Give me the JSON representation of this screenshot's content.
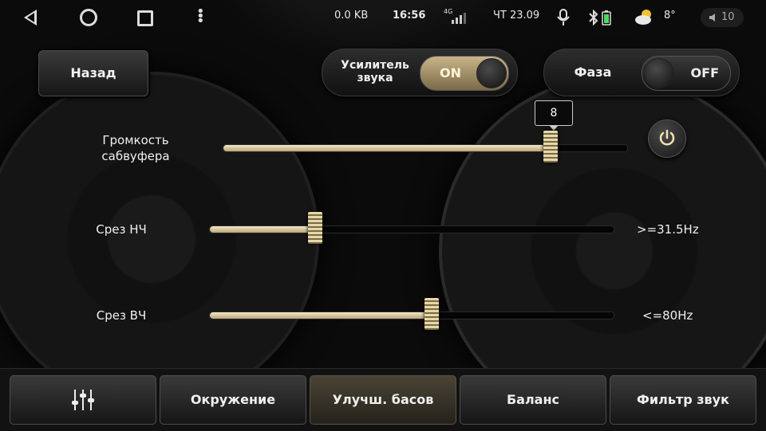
{
  "status": {
    "data_rate": "0.0 KB",
    "time": "16:56",
    "network": "4G",
    "date": "ЧТ 23.09",
    "temperature": "8°",
    "volume": "10"
  },
  "header": {
    "back_label": "Назад",
    "amplifier": {
      "label": "Усилитель звука",
      "state": "ON"
    },
    "phase": {
      "label": "Фаза",
      "state": "OFF"
    }
  },
  "sliders": [
    {
      "label": "Громкость сабвуфера",
      "tooltip": "8",
      "position": 0.81
    },
    {
      "label": "Срез НЧ",
      "value": ">=31.5Hz",
      "position": 0.26
    },
    {
      "label": "Срез ВЧ",
      "value": "<=80Hz",
      "position": 0.55
    }
  ],
  "tabs": [
    {
      "label": ""
    },
    {
      "label": "Окружение"
    },
    {
      "label": "Улучш. басов",
      "active": true
    },
    {
      "label": "Баланс"
    },
    {
      "label": "Фильтр звук"
    }
  ],
  "colors": {
    "accent": "#d8c89e",
    "background": "#0b0b0b"
  },
  "icons": [
    "back-nav-icon",
    "home-nav-icon",
    "recents-nav-icon",
    "menu-dots-icon",
    "signal-icon",
    "mic-icon",
    "bluetooth-icon",
    "battery-icon",
    "weather-icon",
    "volume-icon",
    "power-icon",
    "equalizer-icon"
  ]
}
